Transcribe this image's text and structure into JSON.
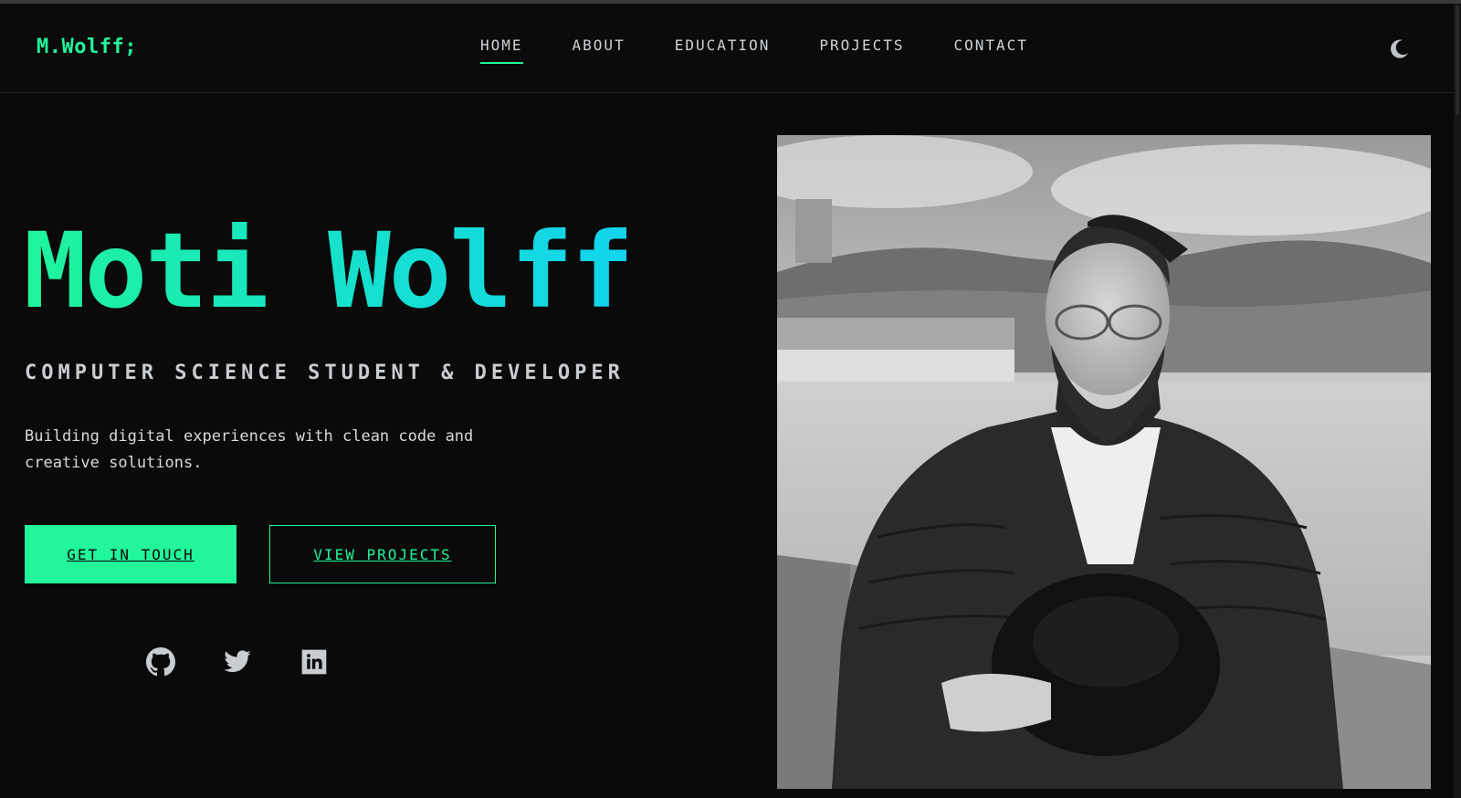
{
  "header": {
    "logo": "M.Wolff;",
    "nav": [
      {
        "label": "HOME",
        "active": true
      },
      {
        "label": "ABOUT",
        "active": false
      },
      {
        "label": "EDUCATION",
        "active": false
      },
      {
        "label": "PROJECTS",
        "active": false
      },
      {
        "label": "CONTACT",
        "active": false
      }
    ],
    "theme_toggle_icon": "moon-icon"
  },
  "hero": {
    "name": "Moti Wolff",
    "subtitle": "COMPUTER SCIENCE STUDENT & DEVELOPER",
    "tagline": "Building digital experiences with clean code and creative solutions.",
    "primary_button": "GET IN TOUCH",
    "secondary_button": "VIEW PROJECTS",
    "socials": [
      "github-icon",
      "twitter-icon",
      "linkedin-icon"
    ]
  },
  "photo": {
    "icon": "portrait-photo"
  },
  "colors": {
    "accent": "#22f59a",
    "accent_cyan": "#12d4ee",
    "background": "#0a0a0a",
    "text": "#c9ccd1"
  }
}
